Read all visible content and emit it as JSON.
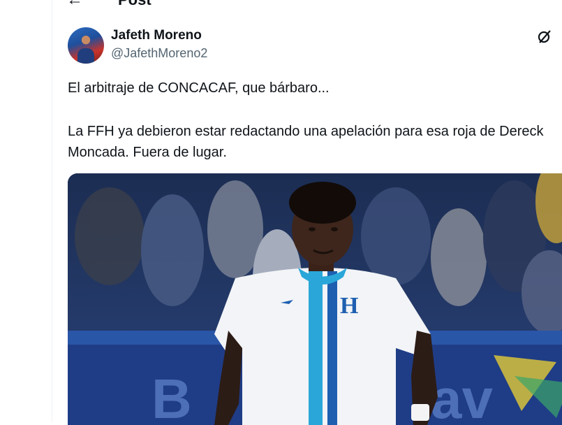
{
  "header": {
    "title": "Post",
    "back_icon": "arrow-left-icon"
  },
  "post": {
    "author_name": "Jafeth Moreno",
    "author_handle": "@JafethMoreno2",
    "text_line1": "El arbitraje de CONCACAF, que bárbaro...",
    "text_paragraph2": "La FFH ya debieron estar redactando una apelación para esa roja de Dereck Moncada. Fuera de lugar.",
    "grok_icon": "grok-icon"
  },
  "colors": {
    "text": "#0f1419",
    "secondary": "#536471",
    "border": "#eff3f4",
    "jersey_blue": "#2aa7d8"
  }
}
